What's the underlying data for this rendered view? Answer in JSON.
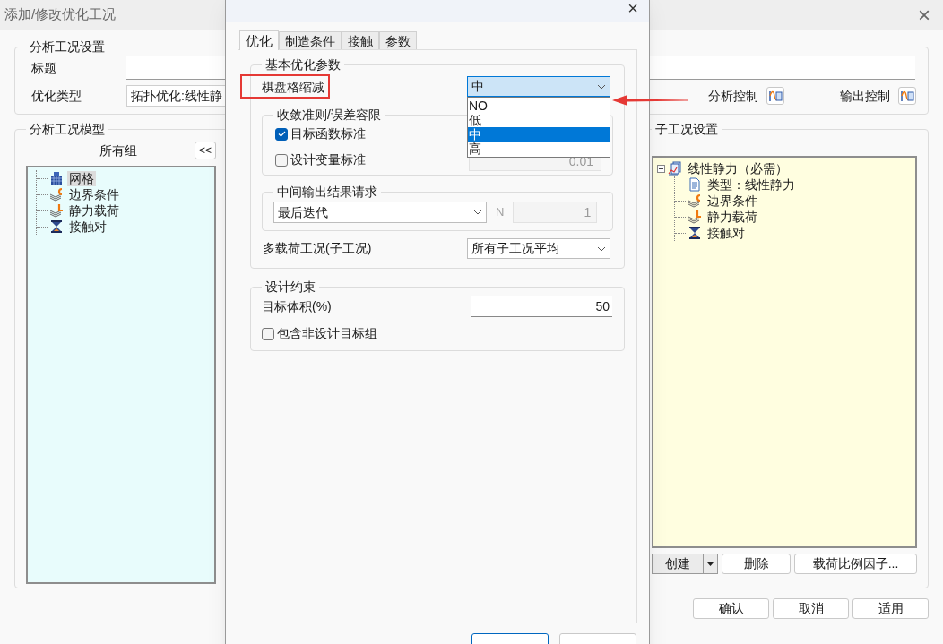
{
  "window": {
    "title": "添加/修改优化工况",
    "close": "×"
  },
  "case_settings": {
    "title": "分析工况设置",
    "title_field": {
      "label": "标题"
    },
    "type_field": {
      "label": "优化类型",
      "value": "拓扑优化:线性静"
    },
    "controls": [
      {
        "label": "分析控制"
      },
      {
        "label": "输出控制"
      }
    ]
  },
  "model": {
    "title": "分析工况模型",
    "header": "所有组",
    "move_button": "<<",
    "tree": [
      {
        "label": "网格",
        "kind": "mesh",
        "selected": true
      },
      {
        "label": "边界条件",
        "kind": "constraint",
        "selected": false
      },
      {
        "label": "静力载荷",
        "kind": "load",
        "selected": false
      },
      {
        "label": "接触对",
        "kind": "contact",
        "selected": false
      }
    ]
  },
  "subcases": {
    "title": "子工况设置",
    "tree": [
      {
        "label": "线性静力（必需）",
        "kind": "analysis",
        "selected": false,
        "expanded": true,
        "children": [
          {
            "label": "类型：线性静力",
            "kind": "doc",
            "selected": false
          },
          {
            "label": "边界条件",
            "kind": "constraint",
            "selected": false
          },
          {
            "label": "静力载荷",
            "kind": "load",
            "selected": false
          },
          {
            "label": "接触对",
            "kind": "contact",
            "selected": false
          }
        ]
      }
    ],
    "buttons": [
      {
        "label": "创建",
        "kind": "split"
      },
      {
        "label": "删除",
        "kind": "plain"
      },
      {
        "label": "载荷比例因子...",
        "kind": "plain"
      }
    ]
  },
  "footer_buttons": [
    "确认",
    "取消",
    "适用"
  ],
  "dialog": {
    "close": "×",
    "tabs": [
      {
        "label": "优化",
        "selected": true
      },
      {
        "label": "制造条件",
        "selected": false
      },
      {
        "label": "接触",
        "selected": false
      },
      {
        "label": "参数",
        "selected": false
      }
    ],
    "basic": {
      "title": "基本优化参数",
      "checkerboard": {
        "label": "棋盘格缩减",
        "value": "中",
        "expanded": true,
        "highlighted": true,
        "options": [
          {
            "label": "NO",
            "selected": false
          },
          {
            "label": "低",
            "selected": false
          },
          {
            "label": "中",
            "selected": true
          },
          {
            "label": "高",
            "selected": false
          }
        ]
      },
      "convergence": {
        "title": "收敛准则/误差容限",
        "checks": [
          {
            "label": "目标函数标准",
            "checked": true
          },
          {
            "label": "设计变量标准",
            "checked": false
          }
        ],
        "tolerance": "0.01"
      },
      "intermediate": {
        "title": "中间输出结果请求",
        "value": "最后迭代",
        "n_label": "N",
        "n_value": "1"
      },
      "multi_load": {
        "label": "多载荷工况(子工况)",
        "value": "所有子工况平均"
      }
    },
    "constraints": {
      "title": "设计约束",
      "volume": {
        "label": "目标体积(%)",
        "value": "50"
      },
      "include": {
        "label": "包含非设计目标组",
        "checked": false
      }
    },
    "buttons": [
      {
        "kind": "default"
      },
      {
        "kind": "plain"
      }
    ]
  },
  "annotation": {
    "arrow": true
  }
}
